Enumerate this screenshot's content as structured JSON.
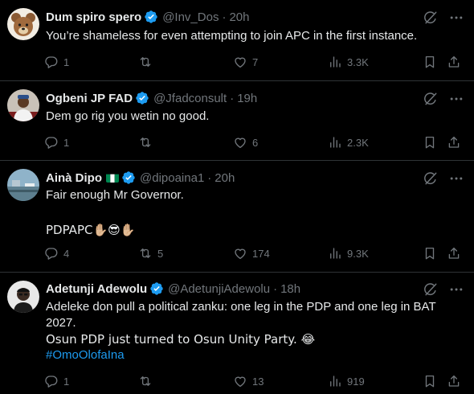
{
  "tweets": [
    {
      "name": "Dum spiro spero",
      "handle": "@Inv_Dos",
      "sep": "·",
      "time": "20h",
      "lines": [
        "You’re shameless for even attempting to join APC in the first instance."
      ],
      "replies": "1",
      "reposts": "",
      "likes": "7",
      "views": "3.3K",
      "avatar_icon": "teddy-bear-avatar"
    },
    {
      "name": "Ogbeni JP FAD",
      "handle": "@Jfadconsult",
      "sep": "·",
      "time": "19h",
      "lines": [
        "Dem go rig you wetin no good."
      ],
      "replies": "1",
      "reposts": "",
      "likes": "6",
      "views": "2.3K",
      "avatar_icon": "person-avatar"
    },
    {
      "name": "Ainà Dipo",
      "handle": "@dipoaina1",
      "sep": "·",
      "time": "20h",
      "lines": [
        "Fair enough Mr Governor.",
        "",
        "PDPAPC✋🏼😎✋🏼"
      ],
      "replies": "4",
      "reposts": "5",
      "likes": "174",
      "views": "9.3K",
      "avatar_icon": "landscape-avatar",
      "flag": "nigeria-flag-icon"
    },
    {
      "name": "Adetunji Adewolu",
      "handle": "@AdetunjiAdewolu",
      "sep": "·",
      "time": "18h",
      "lines": [
        "Adeleke don pull a political zanku: one leg in the PDP and one leg in BAT",
        "2027.",
        "Osun PDP just turned to Osun Unity Party. 😂"
      ],
      "hashtag": "#OmoOlofaIna",
      "replies": "1",
      "reposts": "",
      "likes": "13",
      "views": "919",
      "avatar_icon": "portrait-avatar"
    }
  ],
  "colors": {
    "background": "#000000",
    "text": "#e7e9ea",
    "muted": "#71767b",
    "accent": "#1d9bf0",
    "divider": "#2f3336"
  }
}
